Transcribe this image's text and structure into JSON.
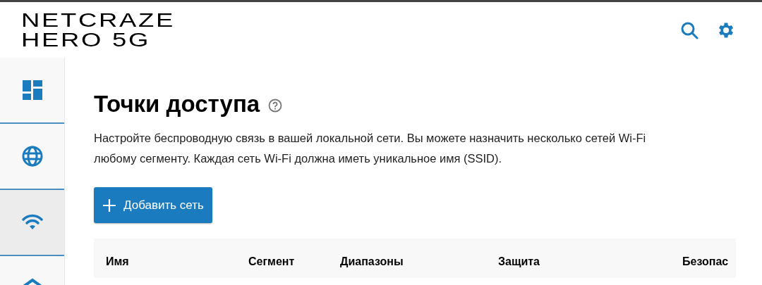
{
  "header": {
    "logo_lines": [
      "NETCRAZE",
      "HERO 5G"
    ]
  },
  "sidebar": {
    "items": [
      {
        "kind": "dashboard",
        "selected": false
      },
      {
        "kind": "globe",
        "selected": false
      },
      {
        "kind": "wifi",
        "selected": true
      },
      {
        "kind": "home",
        "selected": false
      }
    ]
  },
  "page": {
    "title": "Точки доступа",
    "description": "Настройте беспроводную связь в вашей локальной сети. Вы можете назначить несколько сетей Wi-Fi любому сегменту. Каждая сеть Wi-Fi должна иметь уникальное имя (SSID).",
    "add_button": "Добавить сеть"
  },
  "table": {
    "columns": [
      "Имя",
      "Сегмент",
      "Диапазоны",
      "Защита",
      "Безопас"
    ]
  }
}
